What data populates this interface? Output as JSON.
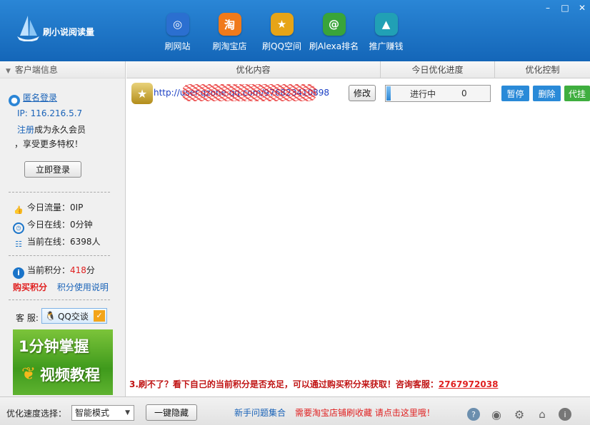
{
  "app": {
    "title": "刷小说阅读量"
  },
  "window_controls": {
    "minimize": "–",
    "maximize": "□",
    "close": "✕"
  },
  "nav": [
    {
      "label": "刷网站",
      "icon": "globe-icon",
      "color": "#2b6fd0",
      "glyph": "◎"
    },
    {
      "label": "刷淘宝店",
      "icon": "taobao-icon",
      "color": "#f07a1a",
      "glyph": "淘"
    },
    {
      "label": "刷QQ空间",
      "icon": "star-icon",
      "color": "#e6a417",
      "glyph": "★"
    },
    {
      "label": "刷Alexa排名",
      "icon": "at-icon",
      "color": "#39a43a",
      "glyph": "@"
    },
    {
      "label": "推广赚钱",
      "icon": "rocket-icon",
      "color": "#21a0b5",
      "glyph": "▲"
    }
  ],
  "sidebar": {
    "header": "客户端信息",
    "login_name": "匿名登录",
    "ip_label": "IP: 116.216.5.7",
    "register_link": "注册",
    "register_text": "成为永久会员",
    "privilege_text": "，享受更多特权！",
    "login_button": "立即登录",
    "today_traffic": "今日流量：0IP",
    "today_online": "今日在线：0分钟",
    "current_online": "当前在线：6398人",
    "points_label": "当前积分：",
    "points_value": "418",
    "points_unit": "分",
    "buy_points": "购买积分",
    "points_help": "积分使用说明",
    "service_label": "客 服:",
    "qq_button": "QQ交谈",
    "video_line1": "1分钟掌握",
    "video_line2": "视频教程"
  },
  "table": {
    "headers": [
      "优化内容",
      "今日优化进度",
      "优化控制"
    ],
    "row": {
      "url": "http://user.qzone.qq.com/976823410898",
      "edit_button": "修改",
      "progress_status": "进行中",
      "progress_value": "0",
      "progress_fraction": 0.04,
      "pause_button": "暂停",
      "delete_button": "删除",
      "proxy_button": "代挂"
    }
  },
  "notice": {
    "text": "3.刷不了？看下自己的当前积分是否充足，可以通过购买积分来获取！咨询客服：",
    "number": "2767972038"
  },
  "statusbar": {
    "speed_label": "优化速度选择：",
    "speed_value": "智能模式",
    "hide_button": "一键隐藏",
    "faq_link": "新手问题集合",
    "promo_link": "需要淘宝店铺刷收藏 请点击这里哦！"
  },
  "colors": {
    "accent": "#1a74c9",
    "action_blue": "#2a8ad8",
    "action_green": "#3fae3f",
    "alert_red": "#e02020"
  }
}
